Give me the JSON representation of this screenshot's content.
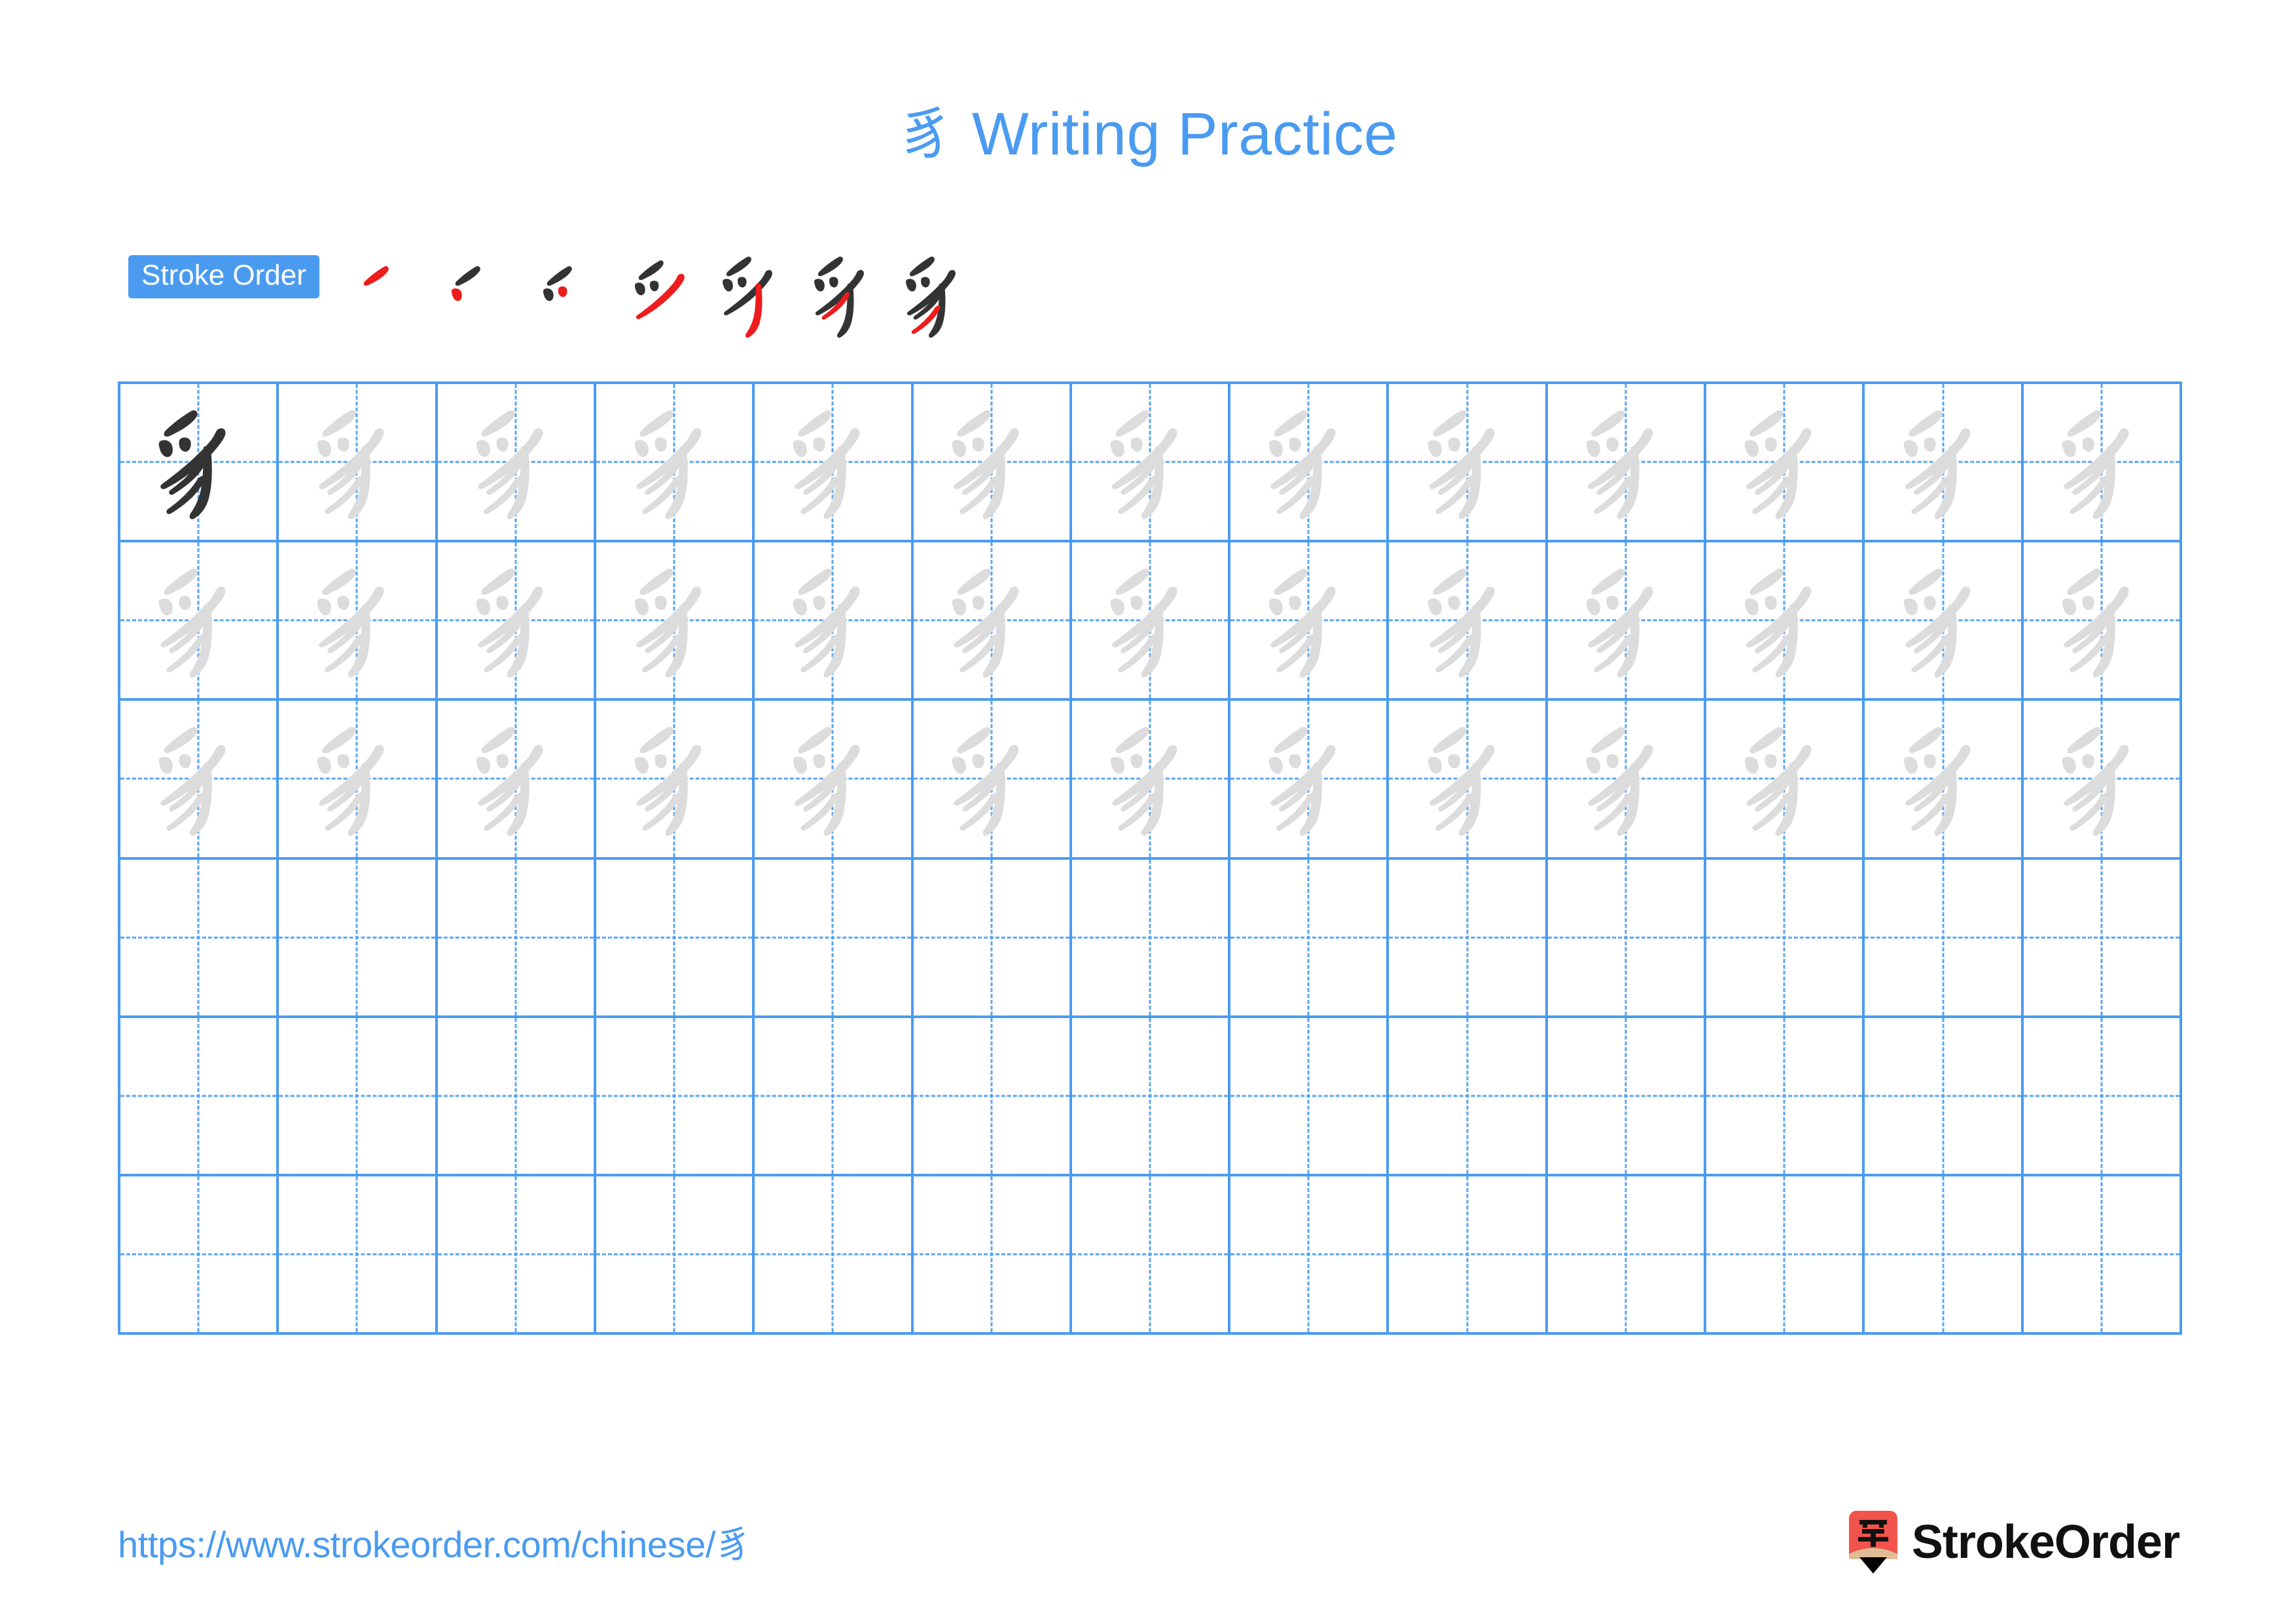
{
  "page": {
    "character": "豸",
    "title": "豸 Writing Practice",
    "title_suffix": " Writing Practice",
    "background_color": "#ffffff",
    "accent_color": "#4a9bf0"
  },
  "stroke_order": {
    "badge_label": "Stroke Order",
    "badge_bg_color": "#4a9bf0",
    "badge_text_color": "#ffffff",
    "total_strokes": 7,
    "new_stroke_color": "#ee1c1c",
    "existing_stroke_color": "#333333",
    "steps": [
      {
        "step": 1,
        "strokes_shown": 1,
        "new_stroke_index": 1
      },
      {
        "step": 2,
        "strokes_shown": 2,
        "new_stroke_index": 2
      },
      {
        "step": 3,
        "strokes_shown": 3,
        "new_stroke_index": 3
      },
      {
        "step": 4,
        "strokes_shown": 4,
        "new_stroke_index": 4
      },
      {
        "step": 5,
        "strokes_shown": 5,
        "new_stroke_index": 5
      },
      {
        "step": 6,
        "strokes_shown": 6,
        "new_stroke_index": 6
      },
      {
        "step": 7,
        "strokes_shown": 7,
        "new_stroke_index": 7
      }
    ]
  },
  "practice_grid": {
    "columns": 13,
    "rows": 6,
    "grid_line_color": "#4a9bf0",
    "guide_line_color": "#5aa5f2",
    "model_glyph_color": "#333333",
    "trace_glyph_color": "#dcdcdc",
    "cells": [
      [
        "model",
        "trace",
        "trace",
        "trace",
        "trace",
        "trace",
        "trace",
        "trace",
        "trace",
        "trace",
        "trace",
        "trace",
        "trace"
      ],
      [
        "trace",
        "trace",
        "trace",
        "trace",
        "trace",
        "trace",
        "trace",
        "trace",
        "trace",
        "trace",
        "trace",
        "trace",
        "trace"
      ],
      [
        "trace",
        "trace",
        "trace",
        "trace",
        "trace",
        "trace",
        "trace",
        "trace",
        "trace",
        "trace",
        "trace",
        "trace",
        "trace"
      ],
      [
        "empty",
        "empty",
        "empty",
        "empty",
        "empty",
        "empty",
        "empty",
        "empty",
        "empty",
        "empty",
        "empty",
        "empty",
        "empty"
      ],
      [
        "empty",
        "empty",
        "empty",
        "empty",
        "empty",
        "empty",
        "empty",
        "empty",
        "empty",
        "empty",
        "empty",
        "empty",
        "empty"
      ],
      [
        "empty",
        "empty",
        "empty",
        "empty",
        "empty",
        "empty",
        "empty",
        "empty",
        "empty",
        "empty",
        "empty",
        "empty",
        "empty"
      ]
    ]
  },
  "footer": {
    "url": "https://www.strokeorder.com/chinese/豸",
    "url_color": "#4a9bf0",
    "brand_name": "StrokeOrder",
    "brand_icon_char": "字",
    "brand_icon_body_color": "#f2534c",
    "brand_icon_wood_color": "#e0bc96",
    "brand_icon_tip_color": "#000000"
  }
}
